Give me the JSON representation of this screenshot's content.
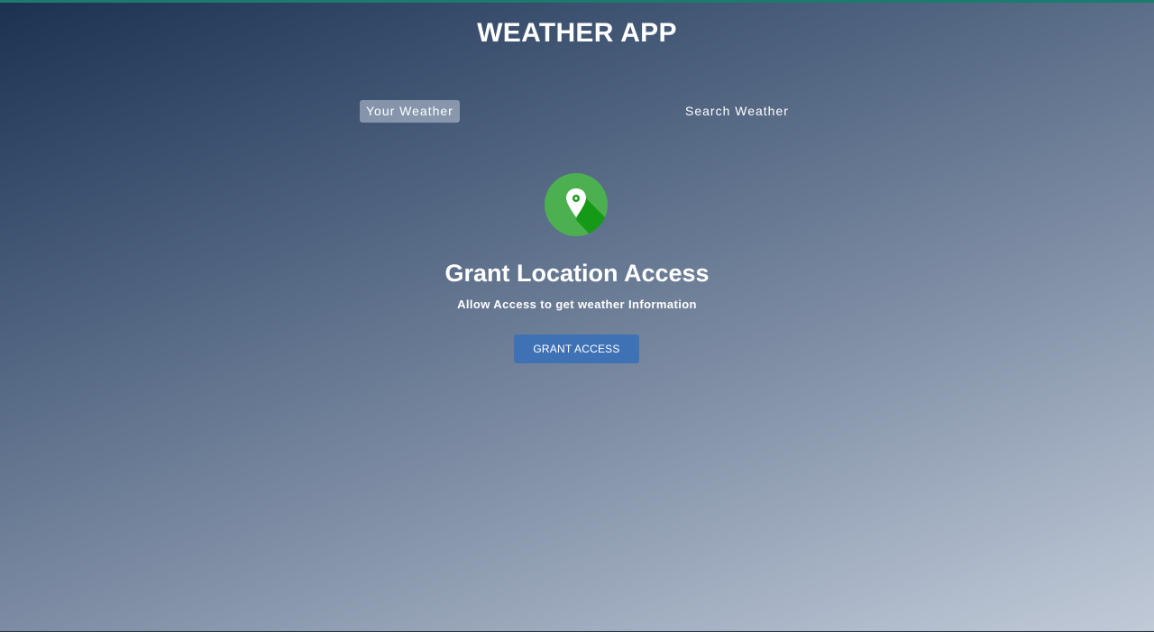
{
  "app": {
    "title": "WEATHER APP"
  },
  "tabs": [
    {
      "label": "Your Weather",
      "active": true
    },
    {
      "label": "Search Weather",
      "active": false
    }
  ],
  "grant_location": {
    "icon": "location-pin-icon",
    "heading": "Grant Location Access",
    "subheading": "Allow Access to get weather Information",
    "button_label": "GRANT ACCESS"
  },
  "colors": {
    "accent_top": "#1d7a6e",
    "button": "#3f72b5",
    "icon_circle": "#4caf50",
    "icon_shadow": "#159a18"
  }
}
